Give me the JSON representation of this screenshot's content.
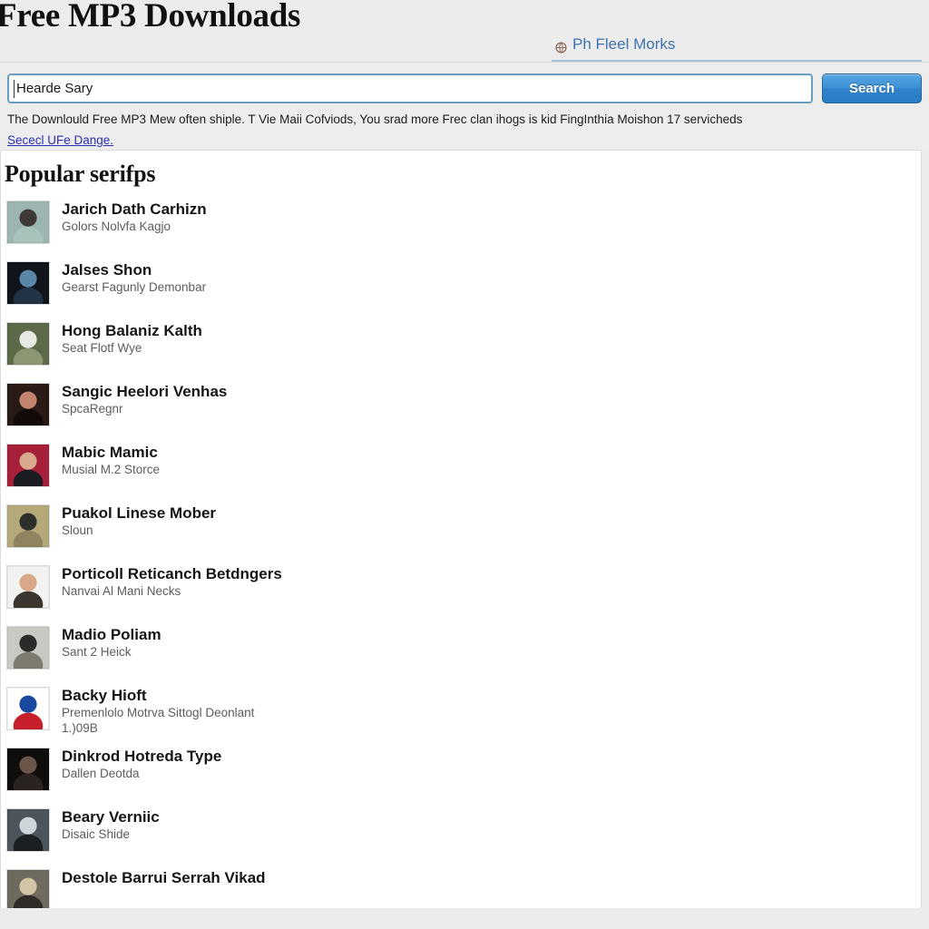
{
  "header": {
    "site_title": "Free MP3 Downloads",
    "tab": {
      "icon": "globe-icon",
      "label": "Ph Fleel Morks"
    }
  },
  "search": {
    "value": "Hearde Sary",
    "placeholder": "Hearde Sary",
    "button_label": "Search",
    "description": "The Downlould Free MP3 Mew often shiple. T Vie Maii Cofviods, You srad more Frec clan ihogs is kid FingInthia Moishon 17 servicheds",
    "link_text": "Sececl UFe Dange.",
    "accent_color": "#2f82c9",
    "link_color": "#2b30b0",
    "border_color": "#6a9fc0"
  },
  "main": {
    "section_title": "Popular serifps",
    "items": [
      {
        "title": "Jarich Dath Carhizn",
        "subtitle": "Golors Nolvfa Kagjo",
        "subtitle2": "",
        "thumb": "portrait-man-teal",
        "colors": [
          "#9db5b0",
          "#3e3a33",
          "#a7c3bb"
        ]
      },
      {
        "title": "Jalses Shon",
        "subtitle": "Gearst Fagunly Demonbar",
        "subtitle2": "",
        "thumb": "portrait-blue-dark",
        "colors": [
          "#10151c",
          "#5a86a8",
          "#223346"
        ]
      },
      {
        "title": "Hong Balaniz Kalth",
        "subtitle": "Seat Flotf Wye",
        "subtitle2": "",
        "thumb": "portrait-white-animal",
        "colors": [
          "#5d6a4a",
          "#e8e8e2",
          "#8d9673"
        ]
      },
      {
        "title": "Sangic Heelori Venhas",
        "subtitle": "SpcaRegnr",
        "subtitle2": "",
        "thumb": "portrait-woman-dark-hair",
        "colors": [
          "#2a1a16",
          "#c4836e",
          "#120b09"
        ]
      },
      {
        "title": "Mabic Mamic",
        "subtitle": "Musial M.2 Storce",
        "subtitle2": "",
        "thumb": "portrait-man-red-bg",
        "colors": [
          "#a6203a",
          "#d8a98e",
          "#1b1b22"
        ]
      },
      {
        "title": "Puakol Linese Mober",
        "subtitle": "Sloun",
        "subtitle2": "",
        "thumb": "portrait-man-olive",
        "colors": [
          "#b5a97a",
          "#2d2f2b",
          "#8e8460"
        ]
      },
      {
        "title": "Porticoll Reticanch Betdngers",
        "subtitle": "Nanvai Al Mani Necks",
        "subtitle2": "",
        "thumb": "portrait-man-white-bg",
        "colors": [
          "#f2f2f0",
          "#d9a888",
          "#3b3730"
        ]
      },
      {
        "title": "Madio Poliam",
        "subtitle": "Sant 2 Heick",
        "subtitle2": "",
        "thumb": "portrait-person-van",
        "colors": [
          "#c9c9c4",
          "#2b2b2b",
          "#7d7a70"
        ]
      },
      {
        "title": "Backy Hioft",
        "subtitle": "Premenlolo Motrva Sittogl Deonlant",
        "subtitle2": "1.)09B",
        "thumb": "album-cover-number-one",
        "colors": [
          "#ffffff",
          "#1a49a0",
          "#c8202a"
        ]
      },
      {
        "title": "Dinkrod Hotreda Type",
        "subtitle": "Dallen Deotda",
        "subtitle2": "",
        "thumb": "portrait-hat-dark",
        "colors": [
          "#100e0d",
          "#6b564a",
          "#2a2320"
        ]
      },
      {
        "title": "Beary Verniic",
        "subtitle": "Disaic Shide",
        "subtitle2": "",
        "thumb": "portrait-woman-moody",
        "colors": [
          "#4d555c",
          "#cfd6da",
          "#1b1f23"
        ]
      },
      {
        "title": "Destole Barrui Serrah Vikad",
        "subtitle": "",
        "subtitle2": "",
        "thumb": "portrait-group-scene",
        "colors": [
          "#6f6a5e",
          "#d2c4a6",
          "#2f2b26"
        ]
      }
    ]
  }
}
